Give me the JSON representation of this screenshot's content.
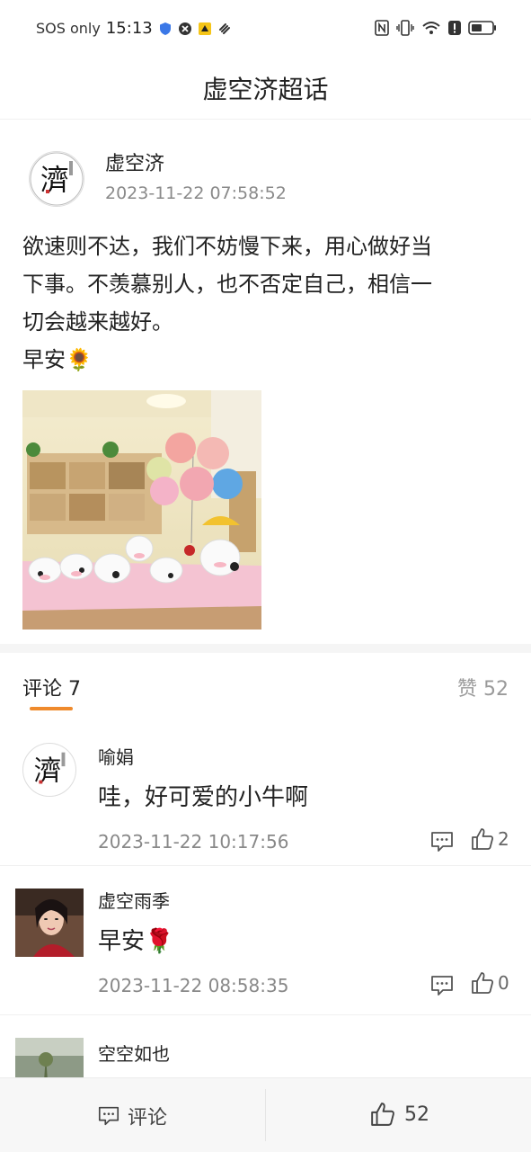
{
  "status_bar": {
    "carrier": "SOS only",
    "time": "15:13"
  },
  "header": {
    "title": "虚空济超话"
  },
  "post": {
    "author": "虚空济",
    "timestamp": "2023-11-22 07:58:52",
    "text_lines": [
      "欲速则不达，我们不妨慢下来，用心做好当",
      "下事。不羡慕别人，也不否定自己，相信一",
      "切会越来越好。",
      "早安"
    ],
    "emoji": "🌻",
    "avatar_char": "濟"
  },
  "tabs": {
    "comments_label": "评论 7",
    "likes_label": "赞 52"
  },
  "comments": [
    {
      "author": "喻娟",
      "text": "哇，好可爱的小牛啊",
      "emoji": "",
      "timestamp": "2023-11-22 10:17:56",
      "likes": "2"
    },
    {
      "author": "虚空雨季",
      "text": "早安",
      "emoji": "🌹",
      "timestamp": "2023-11-22 08:58:35",
      "likes": "0"
    },
    {
      "author": "空空如也",
      "text": "",
      "emoji": "",
      "timestamp": "",
      "likes": ""
    }
  ],
  "bottom_bar": {
    "comment_label": "评论",
    "like_count": "52"
  },
  "colors": {
    "accent": "#ef8a2c",
    "muted_text": "#888888"
  }
}
